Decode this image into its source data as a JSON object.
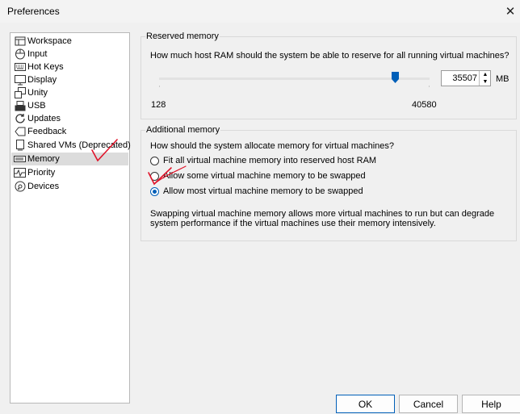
{
  "window": {
    "title": "Preferences",
    "close_glyph": "✕"
  },
  "sidebar": {
    "items": [
      {
        "label": "Workspace",
        "icon": "workspace-icon"
      },
      {
        "label": "Input",
        "icon": "mouse-icon"
      },
      {
        "label": "Hot Keys",
        "icon": "keyboard-icon"
      },
      {
        "label": "Display",
        "icon": "monitor-icon"
      },
      {
        "label": "Unity",
        "icon": "unity-icon"
      },
      {
        "label": "USB",
        "icon": "usb-icon"
      },
      {
        "label": "Updates",
        "icon": "refresh-icon"
      },
      {
        "label": "Feedback",
        "icon": "feedback-icon"
      },
      {
        "label": "Shared VMs (Deprecated)",
        "icon": "shared-vm-icon"
      },
      {
        "label": "Memory",
        "icon": "memory-icon",
        "selected": true
      },
      {
        "label": "Priority",
        "icon": "priority-icon"
      },
      {
        "label": "Devices",
        "icon": "devices-icon"
      }
    ]
  },
  "reserved": {
    "title": "Reserved memory",
    "question": "How much host RAM should the system be able to reserve for all running virtual machines?",
    "min": "128",
    "max": "40580",
    "value": "35507",
    "unit": "MB",
    "slider_fraction": 0.873
  },
  "additional": {
    "title": "Additional memory",
    "question": "How should the system allocate memory for virtual machines?",
    "options": [
      {
        "label": "Fit all virtual machine memory into reserved host RAM",
        "checked": false
      },
      {
        "label": "Allow some virtual machine memory to be swapped",
        "checked": false
      },
      {
        "label": "Allow most virtual machine memory to be swapped",
        "checked": true
      }
    ],
    "note_line1": "Swapping virtual machine memory allows more virtual machines to run but can degrade",
    "note_line2": "system performance if the virtual machines use their memory intensively."
  },
  "buttons": {
    "ok": "OK",
    "cancel": "Cancel",
    "help": "Help"
  },
  "colors": {
    "accent": "#005fb8",
    "annotation": "#e0142a"
  }
}
